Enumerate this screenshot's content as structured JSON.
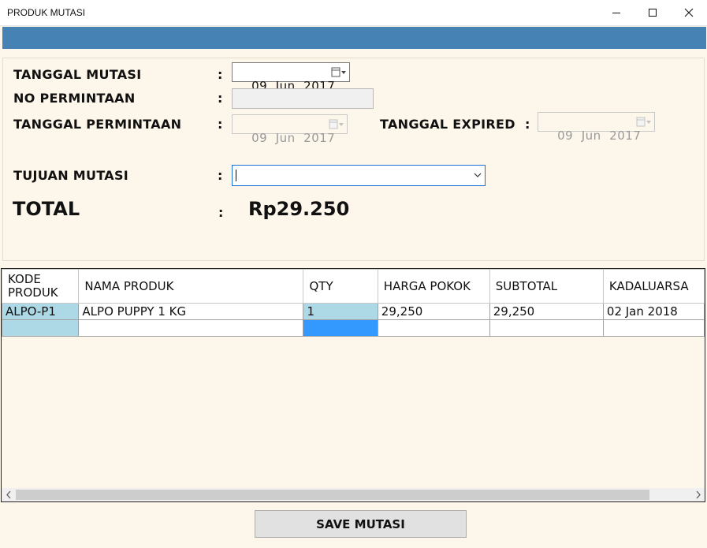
{
  "window": {
    "title": "PRODUK MUTASI"
  },
  "form": {
    "tanggal_mutasi_label": "TANGGAL MUTASI",
    "tanggal_mutasi_value": "09  Jun  2017",
    "no_permintaan_label": "NO PERMINTAAN",
    "no_permintaan_value": "",
    "tanggal_permintaan_label": "TANGGAL PERMINTAAN",
    "tanggal_permintaan_value": "09  Jun  2017",
    "tanggal_expired_label": "TANGGAL EXPIRED",
    "tanggal_expired_value": "09  Jun  2017",
    "tujuan_mutasi_label": "TUJUAN MUTASI",
    "tujuan_mutasi_value": "",
    "colon": ":",
    "total_label": "TOTAL",
    "total_value": "Rp29.250"
  },
  "grid": {
    "columns": [
      "KODE PRODUK",
      "NAMA PRODUK",
      "QTY",
      "HARGA POKOK",
      "SUBTOTAL",
      "KADALUARSA"
    ],
    "rows": [
      [
        "ALPO-P1",
        "ALPO PUPPY 1 KG",
        "1",
        "29,250",
        "29,250",
        "02 Jan 2018"
      ],
      [
        "",
        "",
        "",
        "",
        "",
        ""
      ]
    ]
  },
  "actions": {
    "save_label": "SAVE MUTASI"
  },
  "colors": {
    "header_bar": "#4682b4",
    "background": "#fdf6ea",
    "selected_cell": "#add8e6",
    "current_cell": "#3399ff"
  },
  "icons": [
    "minimize-icon",
    "maximize-icon",
    "close-icon",
    "calendar-icon",
    "chevron-down-icon",
    "scroll-left-icon",
    "scroll-right-icon"
  ]
}
